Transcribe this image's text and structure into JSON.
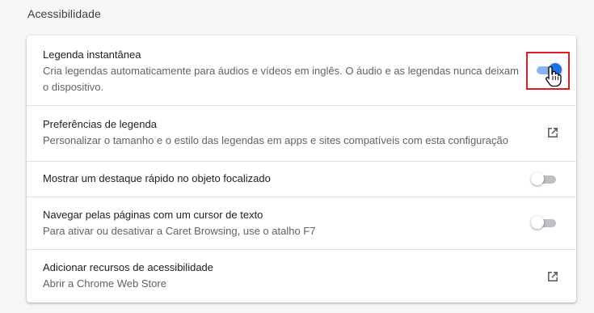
{
  "section": {
    "title": "Acessibilidade"
  },
  "rows": [
    {
      "title": "Legenda instantânea",
      "line1": "Cria legendas automaticamente para áudios e vídeos em inglês. O áudio e as legendas nunca deixam",
      "line2": "o dispositivo.",
      "control": "toggle",
      "checked": true
    },
    {
      "title": "Preferências de legenda",
      "subtitle": "Personalizar o tamanho e o estilo das legendas em apps e sites compatíveis com esta configuração",
      "control": "external-link-icon"
    },
    {
      "title": "Mostrar um destaque rápido no objeto focalizado",
      "control": "toggle",
      "checked": false
    },
    {
      "title": "Navegar pelas páginas com um cursor de texto",
      "subtitle": "Para ativar ou desativar a Caret Browsing, use o atalho F7",
      "control": "toggle",
      "checked": false
    },
    {
      "title": "Adicionar recursos de acessibilidade",
      "subtitle": "Abrir a Chrome Web Store",
      "control": "external-link-icon"
    }
  ],
  "colors": {
    "accent": "#1a73e8",
    "accent_track": "#8ab4f8",
    "off_track": "#bdc1c6",
    "highlight": "#e01b24",
    "page_bg": "#f6f6f6",
    "card_bg": "#ffffff",
    "divider": "#e0e0e0"
  }
}
